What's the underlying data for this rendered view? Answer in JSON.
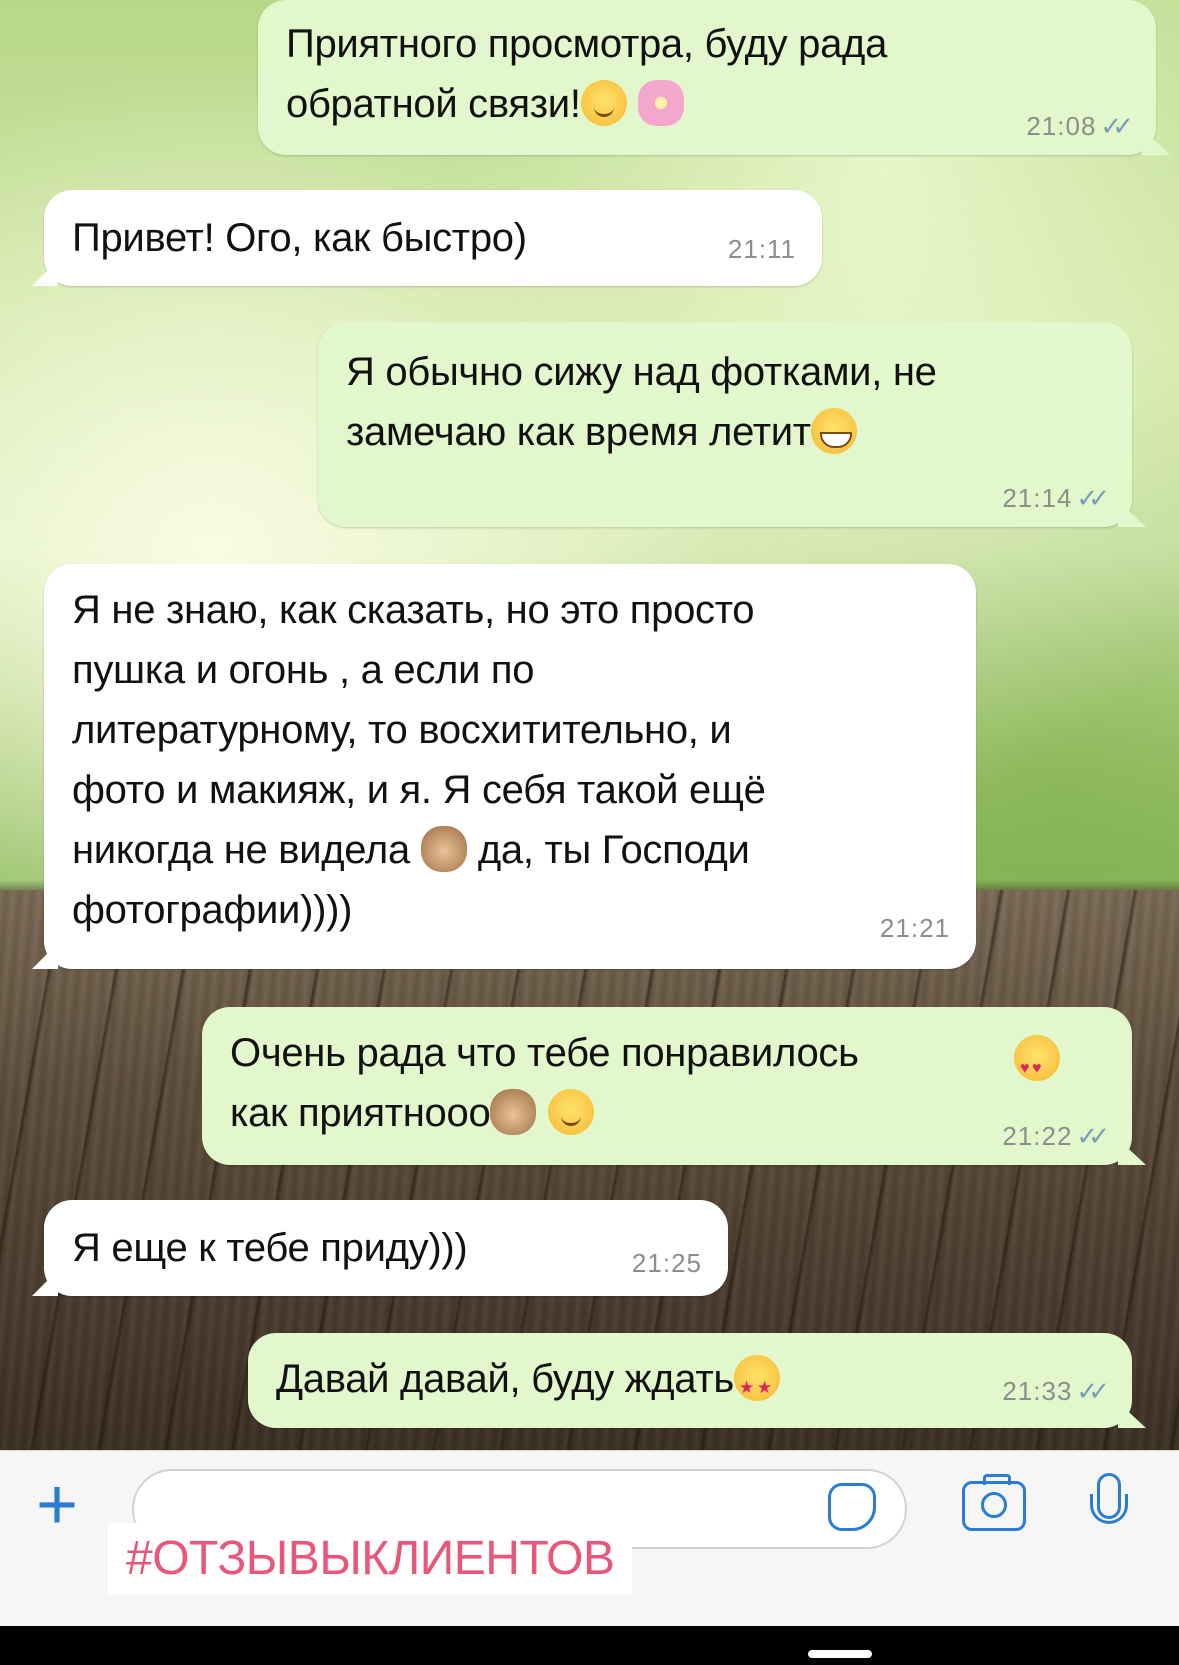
{
  "messages": [
    {
      "direction": "out",
      "text": "Приятного просмотра, буду рада\nобратной связи!",
      "emoji": [
        "smile-blush-icon",
        "flower-icon"
      ],
      "time": "21:08",
      "read": true
    },
    {
      "direction": "in",
      "text": "Привет! Ого, как быстро)",
      "emoji": [],
      "time": "21:11"
    },
    {
      "direction": "out",
      "text": "Я обычно сижу над фотками, не\nзамечаю как время летит",
      "emoji": [
        "grin-icon"
      ],
      "time": "21:14",
      "read": true
    },
    {
      "direction": "in",
      "text": "Я не знаю, как сказать, но это просто\nпушка и огонь , а если по\nлитературному, то восхитительно, и\nфото и макияж, и я. Я себя такой ещё\nникогда не видела",
      "text_after_emoji": " да, ты Господи\nфотографии))))",
      "emoji": [
        "see-no-evil-monkey-icon"
      ],
      "time": "21:21"
    },
    {
      "direction": "out",
      "text": "Очень рада что тебе понравилось\nкак приятнооо",
      "emoji": [
        "heart-eyes-icon",
        "see-no-evil-monkey-icon",
        "smile-blush-icon"
      ],
      "time": "21:22",
      "read": true
    },
    {
      "direction": "in",
      "text": "Я еще к тебе приду)))",
      "emoji": [],
      "time": "21:25"
    },
    {
      "direction": "out",
      "text": "Давай давай, буду ждать",
      "emoji": [
        "star-struck-icon"
      ],
      "time": "21:33",
      "read": true
    }
  ],
  "composer": {
    "placeholder": "",
    "icons": [
      "plus-icon",
      "sticker-icon",
      "camera-icon",
      "microphone-icon"
    ]
  },
  "overlay": {
    "hashtag": "#ОТЗЫВЫКЛИЕНТОВ"
  },
  "colors": {
    "incoming_bubble": "#ffffff",
    "outgoing_bubble": "#e2f7cb",
    "accent": "#2b7cd3",
    "hashtag": "#e8577a",
    "read_ticks": "#7a9bbd"
  }
}
